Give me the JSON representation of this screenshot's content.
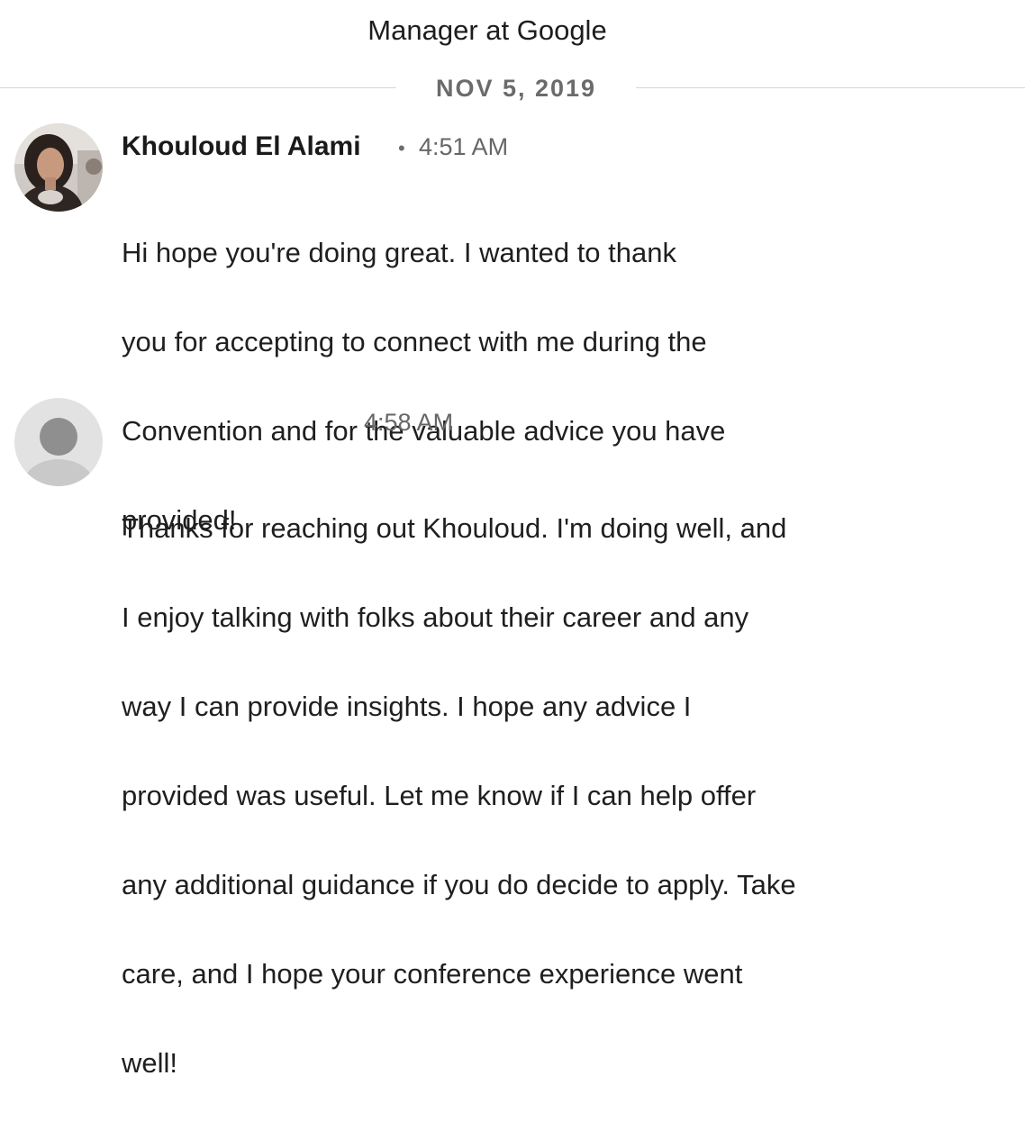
{
  "header": {
    "subtitle": "Manager at Google"
  },
  "date_divider": {
    "label": "NOV 5, 2019"
  },
  "messages": [
    {
      "sender": "Khouloud El Alami",
      "separator": "•",
      "time": "4:51 AM",
      "avatar": "profile-photo",
      "lines": [
        "Hi            hope you're doing great. I wanted to thank",
        "you for accepting to connect with me during the",
        "Convention and for the valuable advice you have",
        "provided!"
      ]
    },
    {
      "sender": "",
      "time": "4:58 AM",
      "avatar": "default-avatar-icon",
      "lines": [
        "Thanks for reaching out Khouloud. I'm doing well, and",
        "I enjoy talking with folks about their career and any",
        "way I can provide insights. I hope any advice I",
        "provided was useful. Let me know if I can help offer",
        "any additional guidance if you do decide to apply. Take",
        "care, and I hope your conference experience went",
        "well!"
      ]
    }
  ]
}
